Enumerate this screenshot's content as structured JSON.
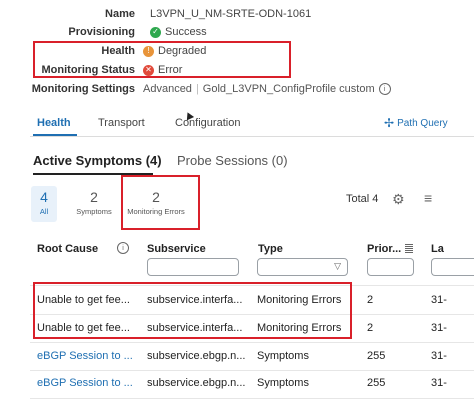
{
  "details": {
    "name_label": "Name",
    "name_value": "L3VPN_U_NM-SRTE-ODN-1061",
    "provisioning_label": "Provisioning",
    "provisioning_value": "Success",
    "health_label": "Health",
    "health_value": "Degraded",
    "monitoring_status_label": "Monitoring Status",
    "monitoring_status_value": "Error",
    "monitoring_settings_label": "Monitoring Settings",
    "monitoring_settings_mode": "Advanced",
    "monitoring_settings_profile": "Gold_L3VPN_ConfigProfile custom"
  },
  "tabs": [
    {
      "label": "Health",
      "active": true
    },
    {
      "label": "Transport",
      "active": false
    },
    {
      "label": "Configuration",
      "active": false
    }
  ],
  "path_query_label": "Path Query",
  "sub_tabs": [
    {
      "label": "Active Symptoms (4)",
      "active": true
    },
    {
      "label": "Probe Sessions (0)",
      "active": false
    }
  ],
  "filters": [
    {
      "count": "4",
      "label": "All",
      "selected": true
    },
    {
      "count": "2",
      "label": "Symptoms",
      "selected": false
    },
    {
      "count": "2",
      "label": "Monitoring Errors",
      "selected": false
    }
  ],
  "total_label": "Total 4",
  "table": {
    "columns": [
      "Root Cause",
      "Subservice",
      "Type",
      "Prior...",
      "La"
    ],
    "rows": [
      {
        "root_cause": "Unable to get fee...",
        "subservice": "subservice.interfa...",
        "type": "Monitoring Errors",
        "priority": "2",
        "last": "31-",
        "link": false
      },
      {
        "root_cause": "Unable to get fee...",
        "subservice": "subservice.interfa...",
        "type": "Monitoring Errors",
        "priority": "2",
        "last": "31-",
        "link": false
      },
      {
        "root_cause": "eBGP Session to ...",
        "subservice": "subservice.ebgp.n...",
        "type": "Symptoms",
        "priority": "255",
        "last": "31-",
        "link": true
      },
      {
        "root_cause": "eBGP Session to ...",
        "subservice": "subservice.ebgp.n...",
        "type": "Symptoms",
        "priority": "255",
        "last": "31-",
        "link": true
      }
    ]
  },
  "colors": {
    "accent": "#1f6fb2",
    "success": "#2fa84f",
    "warning": "#e8943a",
    "error": "#e14b3c",
    "highlight_box": "#d9202a"
  }
}
